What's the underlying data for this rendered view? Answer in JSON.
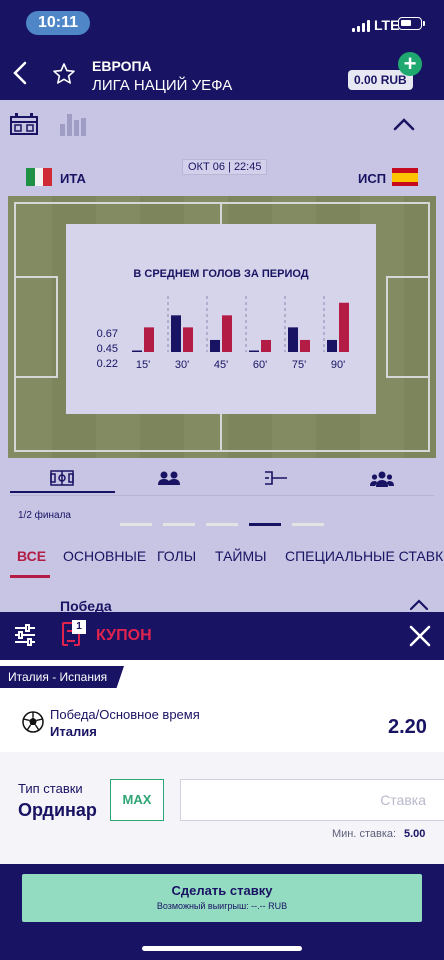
{
  "status_bar": {
    "time": "10:11",
    "network": "LTE"
  },
  "header": {
    "subtitle": "ЕВРОПА",
    "title": "ЛИГА НАЦИЙ УЕФА",
    "balance": "0.00 RUB"
  },
  "match": {
    "date": "ОКТ 06 | 22:45",
    "home": "ИТА",
    "away": "ИСП",
    "round": "1/2 финала",
    "colors": {
      "italy": [
        "#1f9146",
        "#f2f2f2",
        "#cf2b37"
      ],
      "spain": [
        "#c60b1e",
        "#ffc400",
        "#c60b1e"
      ]
    }
  },
  "chart_data": {
    "type": "bar",
    "title": "В СРЕДНЕМ ГОЛОВ ЗА ПЕРИОД",
    "categories": [
      "15'",
      "30'",
      "45'",
      "60'",
      "75'",
      "90'"
    ],
    "y_ticks": [
      "0.67",
      "0.45",
      "0.22"
    ],
    "series": [
      {
        "color": "#191363",
        "values": [
          0.02,
          0.67,
          0.22,
          0.02,
          0.45,
          0.22
        ]
      },
      {
        "color": "#b31d45",
        "values": [
          0.45,
          0.45,
          0.67,
          0.22,
          0.22,
          0.9
        ]
      }
    ],
    "ylim": [
      0,
      0.95
    ],
    "grid": false
  },
  "carousel": {
    "pages": 5,
    "active": 3
  },
  "categories": [
    "ВСЕ",
    "ОСНОВНЫЕ",
    "ГОЛЫ",
    "ТАЙМЫ",
    "СПЕЦИАЛЬНЫЕ СТАВКИ"
  ],
  "market_title": "Победа",
  "coupon": {
    "title": "КУПОН",
    "count": "1",
    "match": "Италия - Испания",
    "outcome": "Победа/Основное время",
    "selection": "Италия",
    "odds": "2.20",
    "bet_type_label": "Тип ставки",
    "bet_type": "Ординар",
    "max_label": "MAX",
    "stake_placeholder": "Ставка",
    "min_label": "Мин. ставка:",
    "min_value": "5.00",
    "place_label": "Сделать ставку",
    "win_label": "Возможный выигрыш: --.-- RUB"
  },
  "accent_colors": {
    "navy": "#191363",
    "red": "#e0234e",
    "green": "#2ea574",
    "button": "#94dcc1"
  }
}
